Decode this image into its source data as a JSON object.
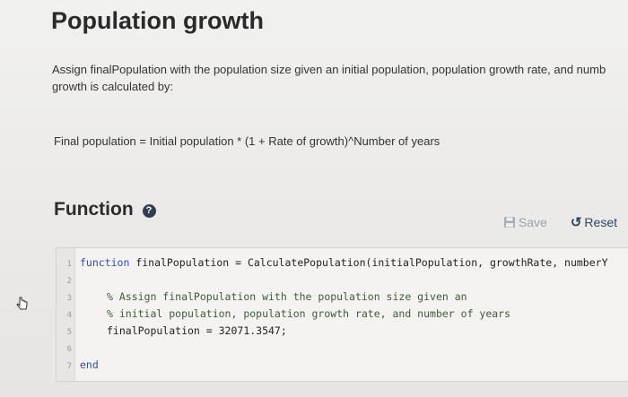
{
  "header": {
    "title": "Population growth"
  },
  "description": {
    "line1": "Assign finalPopulation with the population size given an initial population, population growth rate, and numb",
    "line2": "growth is calculated by:"
  },
  "formula": "Final population = Initial population * (1 + Rate of growth)^Number of years",
  "function_section": {
    "title": "Function",
    "info_icon": "info-circle-icon"
  },
  "toolbar": {
    "save_label": "Save",
    "save_icon": "floppy-disk-icon",
    "reset_label": "Reset",
    "reset_icon": "reset-arrow-icon"
  },
  "editor": {
    "lines": [
      {
        "num": "1",
        "keyword": "function",
        "text": " finalPopulation = CalculatePopulation(initialPopulation, growthRate, numberY"
      },
      {
        "num": "2",
        "keyword": "",
        "text": ""
      },
      {
        "num": "3",
        "keyword": "",
        "text": "% Assign finalPopulation with the population size given an"
      },
      {
        "num": "4",
        "keyword": "",
        "text": "% initial population, population growth rate, and number of years"
      },
      {
        "num": "5",
        "keyword": "",
        "text": "finalPopulation = 32071.3547;"
      },
      {
        "num": "6",
        "keyword": "",
        "text": ""
      },
      {
        "num": "7",
        "keyword": "end",
        "text": ""
      }
    ]
  },
  "colors": {
    "keyword": "#2e4fbf",
    "reset": "#2f4660",
    "save_disabled": "#9aa3ab"
  }
}
